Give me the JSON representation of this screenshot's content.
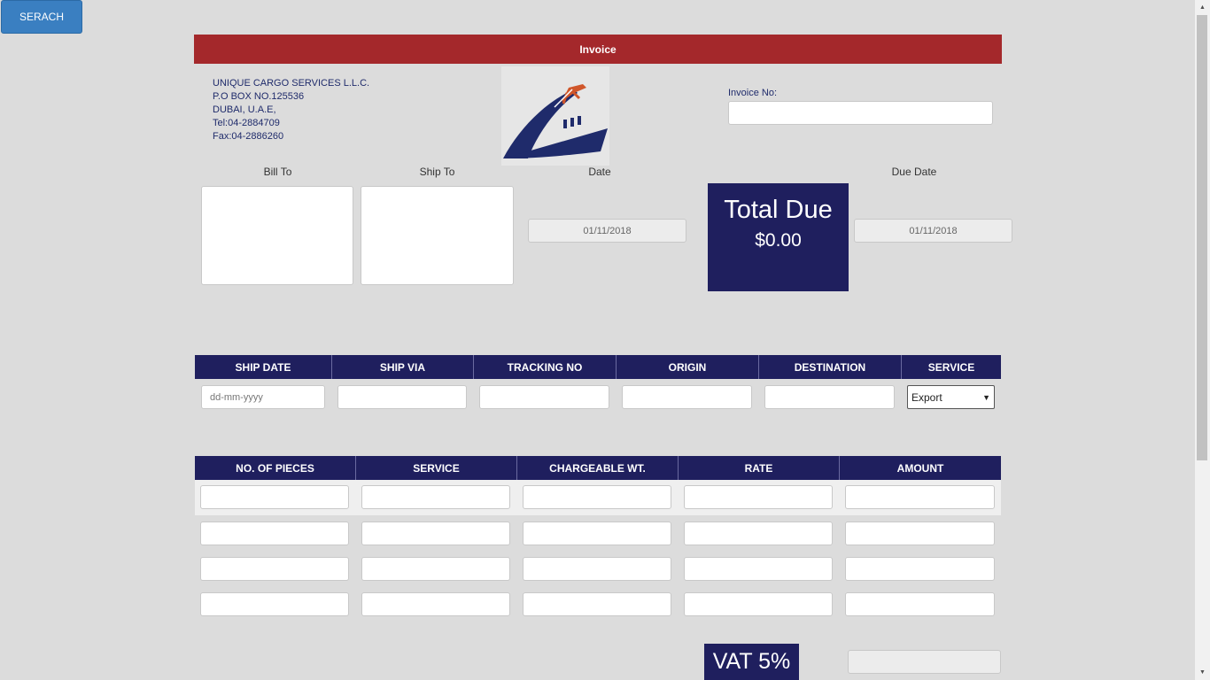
{
  "toolbar": {
    "search_label": "SERACH"
  },
  "header": {
    "title": "Invoice"
  },
  "company": {
    "lines": [
      "UNIQUE CARGO SERVICES L.L.C.",
      "P.O BOX NO.125536",
      "DUBAI, U.A.E,",
      "Tel:04-2884709",
      "Fax:04-2886260"
    ]
  },
  "invoice": {
    "no_label": "Invoice No:",
    "no_value": ""
  },
  "labels": {
    "bill_to": "Bill To",
    "ship_to": "Ship To",
    "date": "Date",
    "due_date": "Due Date"
  },
  "dates": {
    "date_value": "01/11/2018",
    "due_date_value": "01/11/2018"
  },
  "total": {
    "label": "Total Due",
    "value": "$0.00"
  },
  "shipping": {
    "headers": [
      "SHIP DATE",
      "SHIP VIA",
      "TRACKING NO",
      "ORIGIN",
      "DESTINATION",
      "SERVICE"
    ],
    "ship_date_placeholder": "dd-mm-yyyy",
    "service_selected": "Export"
  },
  "items": {
    "headers": [
      "NO. OF PIECES",
      "SERVICE",
      "CHARGEABLE WT.",
      "RATE",
      "AMOUNT"
    ]
  },
  "vat": {
    "label": "VAT 5%"
  },
  "colors": {
    "header_red": "#a4282b",
    "navy": "#1f1f5e",
    "button_blue": "#3a7fc1"
  }
}
